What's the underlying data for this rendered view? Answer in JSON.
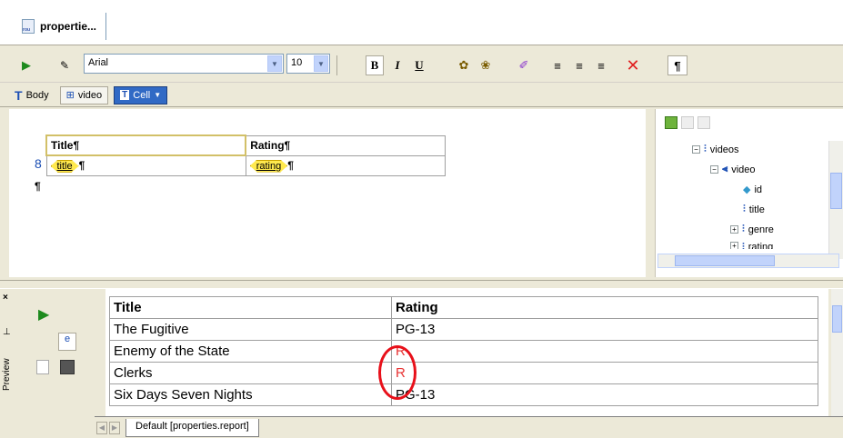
{
  "document_tab": {
    "label": "propertie..."
  },
  "toolbar": {
    "font_name": "Arial",
    "font_size": "10",
    "bold": "B",
    "italic": "I",
    "underline": "U",
    "pilcrow": "¶"
  },
  "breadcrumbs": [
    {
      "label": "Body"
    },
    {
      "label": "video"
    },
    {
      "label": "Cell"
    }
  ],
  "design": {
    "headers": [
      "Title¶",
      "Rating¶"
    ],
    "row_tags": [
      "title",
      "rating"
    ],
    "pilcrow": "¶",
    "trailing_pilcrow": "¶"
  },
  "tree": {
    "nodes": [
      "videos",
      "video",
      "id",
      "title",
      "genre",
      "rating"
    ]
  },
  "preview": {
    "label": "Preview",
    "columns": [
      "Title",
      "Rating"
    ],
    "rows": [
      {
        "title": "The Fugitive",
        "rating": "PG-13"
      },
      {
        "title": "Enemy of the State",
        "rating": "R"
      },
      {
        "title": "Clerks",
        "rating": "R"
      },
      {
        "title": "Six Days Seven Nights",
        "rating": "PG-13"
      }
    ],
    "sheet_tab": "Default [properties.report]"
  },
  "colors": {
    "highlight": "#e8101a",
    "selection": "#316ac5",
    "tag": "#ffe94d"
  }
}
